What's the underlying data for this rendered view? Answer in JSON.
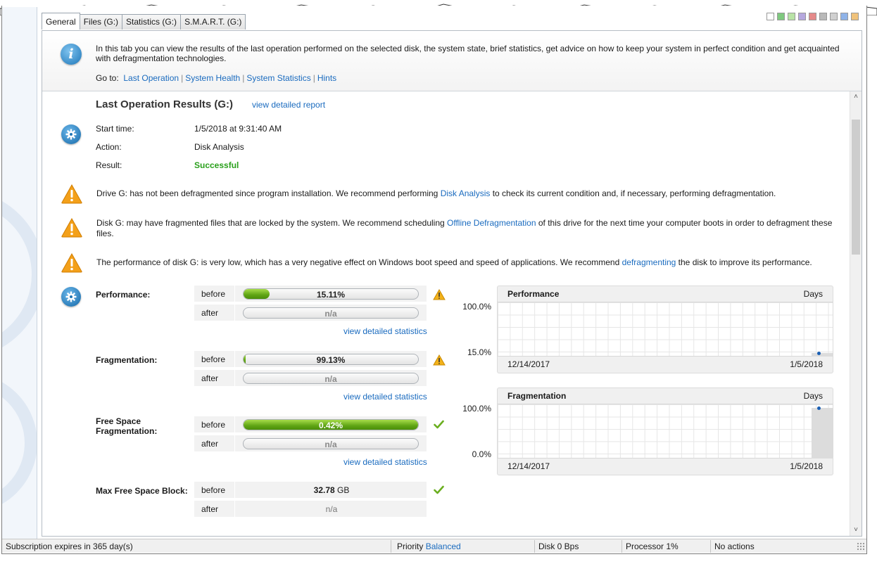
{
  "tabs": [
    "General",
    "Files (G:)",
    "Statistics (G:)",
    "S.M.A.R.T. (G:)"
  ],
  "swatches": [
    "#ffffff",
    "#7fc97f",
    "#b9e3a6",
    "#b6a8de",
    "#e58a8a",
    "#b9b9b9",
    "#d0d0d0",
    "#8fb3e8",
    "#f0c27a"
  ],
  "info": {
    "icon": "info-icon",
    "text": "In this tab you can view the results of the last operation performed on the selected disk, the system state, brief statistics, get advice on how to keep your system in perfect condition and get acquainted with defragmentation technologies.",
    "goto_label": "Go to:",
    "links": [
      "Last Operation",
      "System Health",
      "System Statistics",
      "Hints"
    ]
  },
  "last_op": {
    "title": "Last Operation Results (G:)",
    "report_link": "view detailed report",
    "start_label": "Start time:",
    "start_value": "1/5/2018 at 9:31:40 AM",
    "action_label": "Action:",
    "action_value": "Disk Analysis",
    "result_label": "Result:",
    "result_value": "Successful"
  },
  "warnings": [
    {
      "pre": "Drive G: has not been defragmented since program installation. We recommend performing ",
      "link": "Disk Analysis",
      "post": " to check its current condition and, if necessary, performing defragmentation."
    },
    {
      "pre": "Disk G: may have fragmented files that are locked by the system. We recommend scheduling ",
      "link": "Offline Defragmentation",
      "post": " of this drive for the next time your computer boots in order to defragment these files."
    },
    {
      "pre": "The performance of disk G: is very low, which has a very negative effect on Windows boot speed and speed of applications. We recommend ",
      "link": "defragmenting",
      "post": " the disk to improve its performance."
    }
  ],
  "metrics": {
    "before_label": "before",
    "after_label": "after",
    "stats_link": "view detailed statistics",
    "performance": {
      "label": "Performance:",
      "before": "15.11%",
      "before_fraction": 0.1511,
      "after": "n/a",
      "status": "warning-icon"
    },
    "fragmentation": {
      "label": "Fragmentation:",
      "before": "99.13%",
      "before_fraction": 0.0087,
      "after": "n/a",
      "status": "warning-icon"
    },
    "free_space_frag": {
      "label_line1": "Free Space",
      "label_line2": "Fragmentation:",
      "before": "0.42%",
      "before_fraction": 1.0,
      "after": "n/a",
      "status": "check-icon"
    },
    "max_free_block": {
      "label": "Max Free Space Block:",
      "before_num": "32.78",
      "before_unit": "GB",
      "after": "n/a",
      "status": "check-icon"
    }
  },
  "charts": {
    "performance": {
      "title": "Performance",
      "days": "Days",
      "ymax": "100.0%",
      "ymin": "15.0%",
      "x_start": "12/14/2017",
      "x_end": "1/5/2018"
    },
    "fragmentation": {
      "title": "Fragmentation",
      "days": "Days",
      "ymax": "100.0%",
      "ymin": "0.0%",
      "x_start": "12/14/2017",
      "x_end": "1/5/2018"
    }
  },
  "chart_data": [
    {
      "type": "scatter",
      "title": "Performance",
      "xlabel": "Days",
      "x": [
        "1/5/2018"
      ],
      "y": [
        15.11
      ],
      "xlim": [
        "12/14/2017",
        "1/5/2018"
      ],
      "ylim": [
        15.0,
        100.0
      ],
      "grid": true
    },
    {
      "type": "area",
      "title": "Fragmentation",
      "xlabel": "Days",
      "x": [
        "1/5/2018"
      ],
      "y": [
        99.13
      ],
      "xlim": [
        "12/14/2017",
        "1/5/2018"
      ],
      "ylim": [
        0.0,
        100.0
      ],
      "grid": true
    }
  ],
  "status": {
    "subscription": "Subscription expires in 365 day(s)",
    "priority_label": "Priority",
    "priority_value": "Balanced",
    "disk": "Disk 0 Bps",
    "processor": "Processor 1%",
    "actions": "No actions"
  }
}
